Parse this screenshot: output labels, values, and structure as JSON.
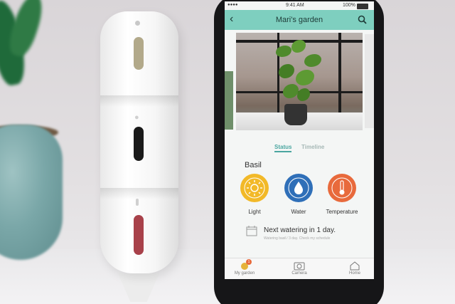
{
  "status_bar": {
    "time": "9:41 AM",
    "battery": "100%"
  },
  "app_bar": {
    "title": "Mari's garden"
  },
  "tabs": [
    {
      "label": "Status",
      "active": true
    },
    {
      "label": "Timeline",
      "active": false
    }
  ],
  "plant": {
    "name": "Basil"
  },
  "indicators": [
    {
      "label": "Light",
      "icon": "sun-icon",
      "color": "#f2b928"
    },
    {
      "label": "Water",
      "icon": "water-drop-icon",
      "color": "#2f6fb8"
    },
    {
      "label": "Temperature",
      "icon": "thermometer-icon",
      "color": "#e86a3c"
    }
  ],
  "watering": {
    "title": "Next watering in 1 day.",
    "subtitle": "Watering basil ⁄ 3 day. Check my schedule"
  },
  "bottom_nav": [
    {
      "label": "My garden",
      "icon": "leaf-icon",
      "badge": "1"
    },
    {
      "label": "Camera",
      "icon": "camera-icon"
    },
    {
      "label": "Home",
      "icon": "home-icon"
    }
  ],
  "colors": {
    "accent": "#7ecfbf",
    "tab_active": "#4aa6a0",
    "sensor_red": "#a8414a",
    "sensor_black": "#1a1a1a",
    "sensor_olive": "#b2a98a"
  }
}
